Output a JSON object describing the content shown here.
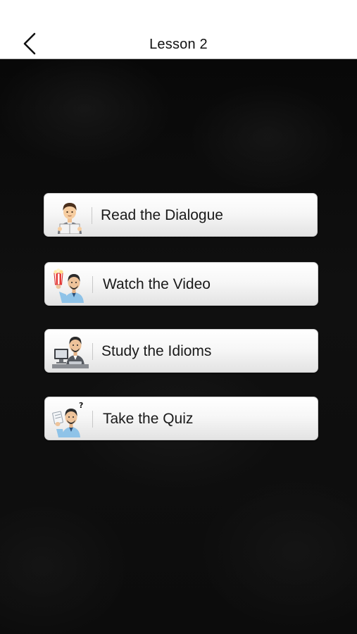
{
  "header": {
    "title": "Lesson 2",
    "back_icon": "chevron-left-icon"
  },
  "menu": {
    "items": [
      {
        "label": "Read the Dialogue",
        "icon": "reading-person-icon"
      },
      {
        "label": "Watch the Video",
        "icon": "popcorn-person-icon"
      },
      {
        "label": "Study the Idioms",
        "icon": "computer-person-icon"
      },
      {
        "label": "Take the Quiz",
        "icon": "question-person-icon"
      }
    ]
  },
  "colors": {
    "background": "#0c0c0c",
    "navbar": "#ffffff",
    "button_top": "#ffffff",
    "button_bottom": "#e3e3e3",
    "text": "#1a1a1a"
  }
}
